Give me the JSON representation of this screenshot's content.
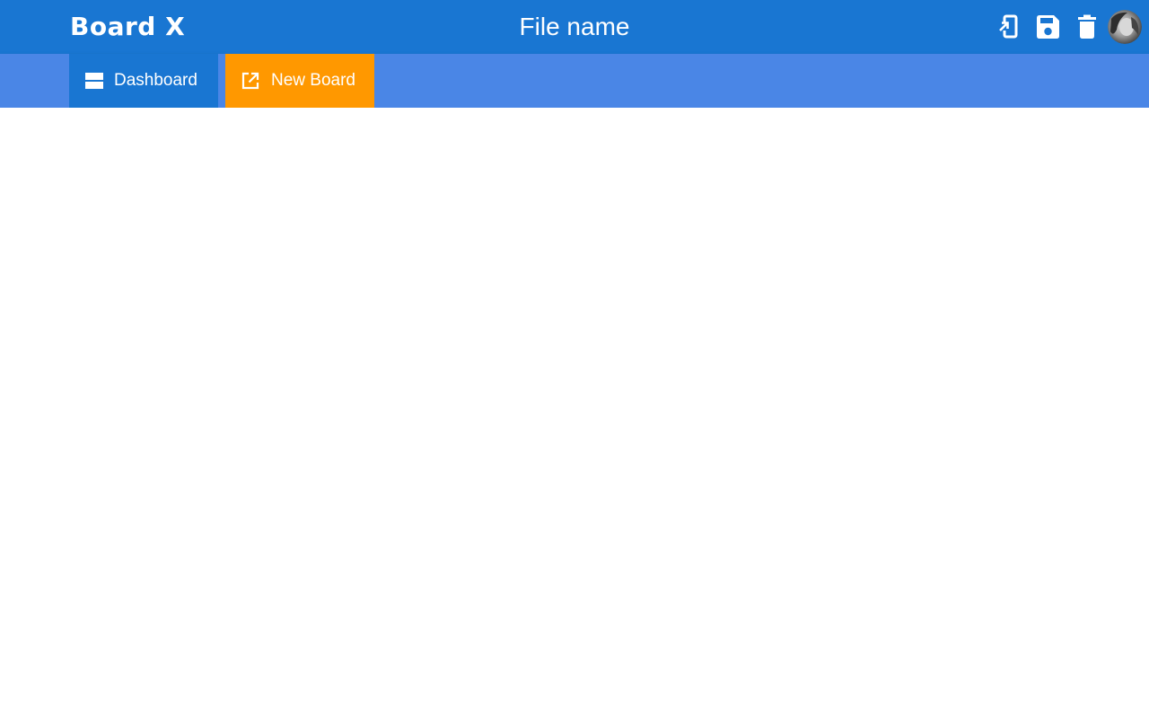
{
  "app": {
    "brand": "Board X",
    "file_name": "File name"
  },
  "toolbar": {
    "actions": [
      {
        "name": "export",
        "icon": "export-icon"
      },
      {
        "name": "save",
        "icon": "save-icon"
      },
      {
        "name": "delete",
        "icon": "trash-icon"
      }
    ],
    "avatar_icon": "user-avatar"
  },
  "tabs": [
    {
      "label": "Dashboard",
      "icon": "dashboard-icon",
      "color": "#1976d2"
    },
    {
      "label": "New Board",
      "icon": "open-in-new-icon",
      "color": "#ff9800"
    }
  ],
  "colors": {
    "header": "#1976d2",
    "tabbar": "#4a86e6",
    "accent": "#ff9800"
  }
}
